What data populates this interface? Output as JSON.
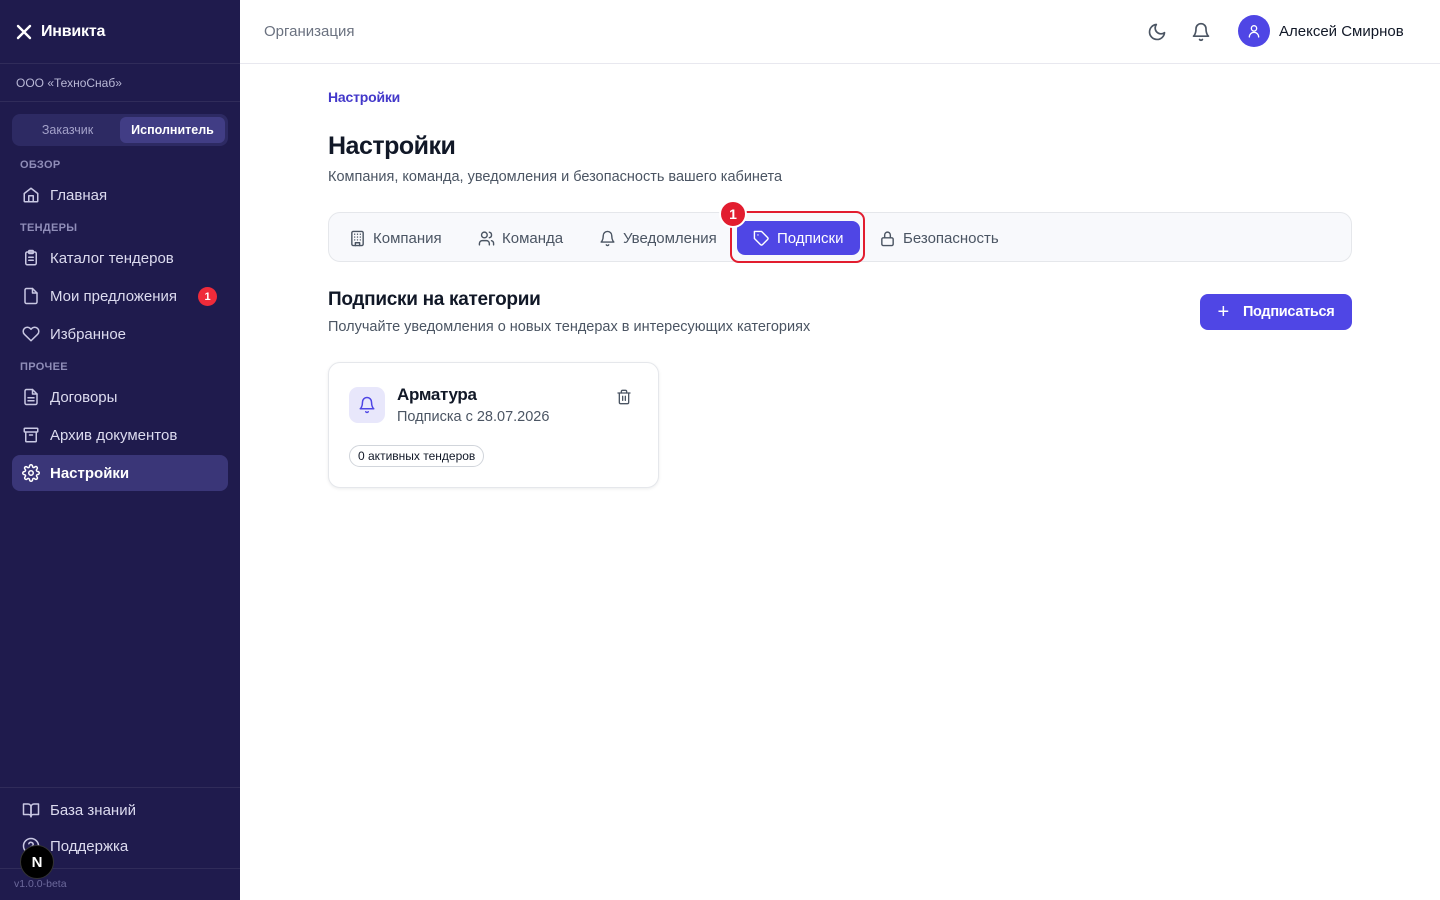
{
  "app": {
    "brand": "Инвикта",
    "org_name": "ООО «ТехноСнаб»",
    "version": "v1.0.0-beta"
  },
  "role_toggle": {
    "options": [
      "Заказчик",
      "Исполнитель"
    ],
    "selected": "Исполнитель"
  },
  "sidebar": {
    "sections": [
      {
        "label": "ОБЗОР"
      },
      {
        "label": "ТЕНДЕРЫ"
      },
      {
        "label": "ПРОЧЕЕ"
      }
    ],
    "items": [
      {
        "label": "Главная",
        "icon": "home-icon"
      },
      {
        "label": "Каталог тендеров",
        "icon": "clipboard-icon"
      },
      {
        "label": "Мои предложения",
        "icon": "document-icon",
        "badge": "1"
      },
      {
        "label": "Избранное",
        "icon": "heart-icon"
      },
      {
        "label": "Договоры",
        "icon": "file-text-icon"
      },
      {
        "label": "Архив документов",
        "icon": "archive-icon"
      },
      {
        "label": "Настройки",
        "icon": "gear-icon",
        "active": true
      }
    ],
    "footer_items": [
      {
        "label": "База знаний",
        "icon": "book-icon"
      },
      {
        "label": "Поддержка",
        "icon": "help-circle-icon"
      }
    ],
    "dev_badge": "N"
  },
  "topbar": {
    "title": "Организация",
    "user_name": "Алексей Смирнов"
  },
  "page": {
    "breadcrumb": "Настройки",
    "title": "Настройки",
    "subtitle": "Компания, команда, уведомления и безопасность вашего кабинета"
  },
  "tabs": [
    {
      "label": "Компания",
      "icon": "building-icon"
    },
    {
      "label": "Команда",
      "icon": "users-icon"
    },
    {
      "label": "Уведомления",
      "icon": "bell-icon"
    },
    {
      "label": "Подписки",
      "icon": "tag-icon",
      "active": true
    },
    {
      "label": "Безопасность",
      "icon": "lock-icon"
    }
  ],
  "annotation": {
    "marker_number": "1"
  },
  "subscriptions": {
    "title": "Подписки на категории",
    "subtitle": "Получайте уведомления о новых тендерах в интересующих категориях",
    "subscribe_label": "Подписаться",
    "cards": [
      {
        "category": "Арматура",
        "since": "Подписка с 28.07.2026",
        "active_count": "0 активных тендеров"
      }
    ]
  },
  "colors": {
    "sidebar_bg": "#1f1b4d",
    "accent": "#4f46e5",
    "annotation_red": "#e21d2f",
    "badge_red": "#ef2b3a"
  }
}
